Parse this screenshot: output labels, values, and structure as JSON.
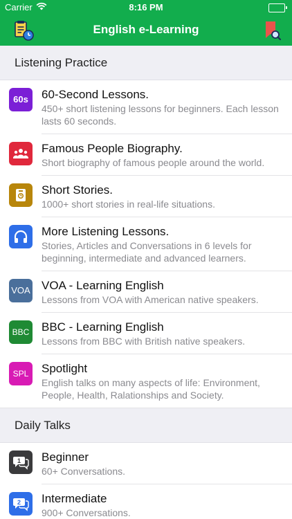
{
  "status_bar": {
    "carrier": "Carrier",
    "time": "8:16 PM"
  },
  "nav": {
    "title": "English e-Learning",
    "left_icon": "notes-clock-icon",
    "right_icon": "bookmark-search-icon"
  },
  "colors": {
    "brand_green": "#12ad4d"
  },
  "sections": [
    {
      "header": "Listening Practice",
      "items": [
        {
          "icon_text": "60s",
          "icon_color": "#7b1fd6",
          "title": "60-Second Lessons.",
          "subtitle": "450+ short listening lessons for beginners. Each lesson lasts 60 seconds."
        },
        {
          "icon_name": "people-icon",
          "icon_color": "#e0283c",
          "title": "Famous People Biography.",
          "subtitle": "Short biography of famous people around the world."
        },
        {
          "icon_name": "story-book-icon",
          "icon_color": "#b8860b",
          "title": "Short Stories.",
          "subtitle": "1000+ short stories in real-life situations."
        },
        {
          "icon_name": "headphones-icon",
          "icon_color": "#2e6ee8",
          "title": "More Listening Lessons.",
          "subtitle": "Stories, Articles and Conversations in 6 levels for beginning, intermediate and advanced learners."
        },
        {
          "icon_text": "VOA",
          "icon_color": "#4a6f9b",
          "title": "VOA - Learning English",
          "subtitle": "Lessons from VOA with American native speakers."
        },
        {
          "icon_text": "BBC",
          "icon_color": "#1f8a34",
          "title": "BBC - Learning English",
          "subtitle": "Lessons from BBC with British native speakers."
        },
        {
          "icon_text": "SPL",
          "icon_color": "#d81bb4",
          "title": "Spotlight",
          "subtitle": "English talks on many aspects of life: Environment, People, Health, Ralationships and Society."
        }
      ]
    },
    {
      "header": "Daily Talks",
      "items": [
        {
          "icon_name": "chat-1-icon",
          "icon_color": "#3a3a3c",
          "title": "Beginner",
          "subtitle": "60+ Conversations."
        },
        {
          "icon_name": "chat-2-icon",
          "icon_color": "#2e6ee8",
          "title": "Intermediate",
          "subtitle": "900+ Conversations."
        }
      ]
    }
  ]
}
